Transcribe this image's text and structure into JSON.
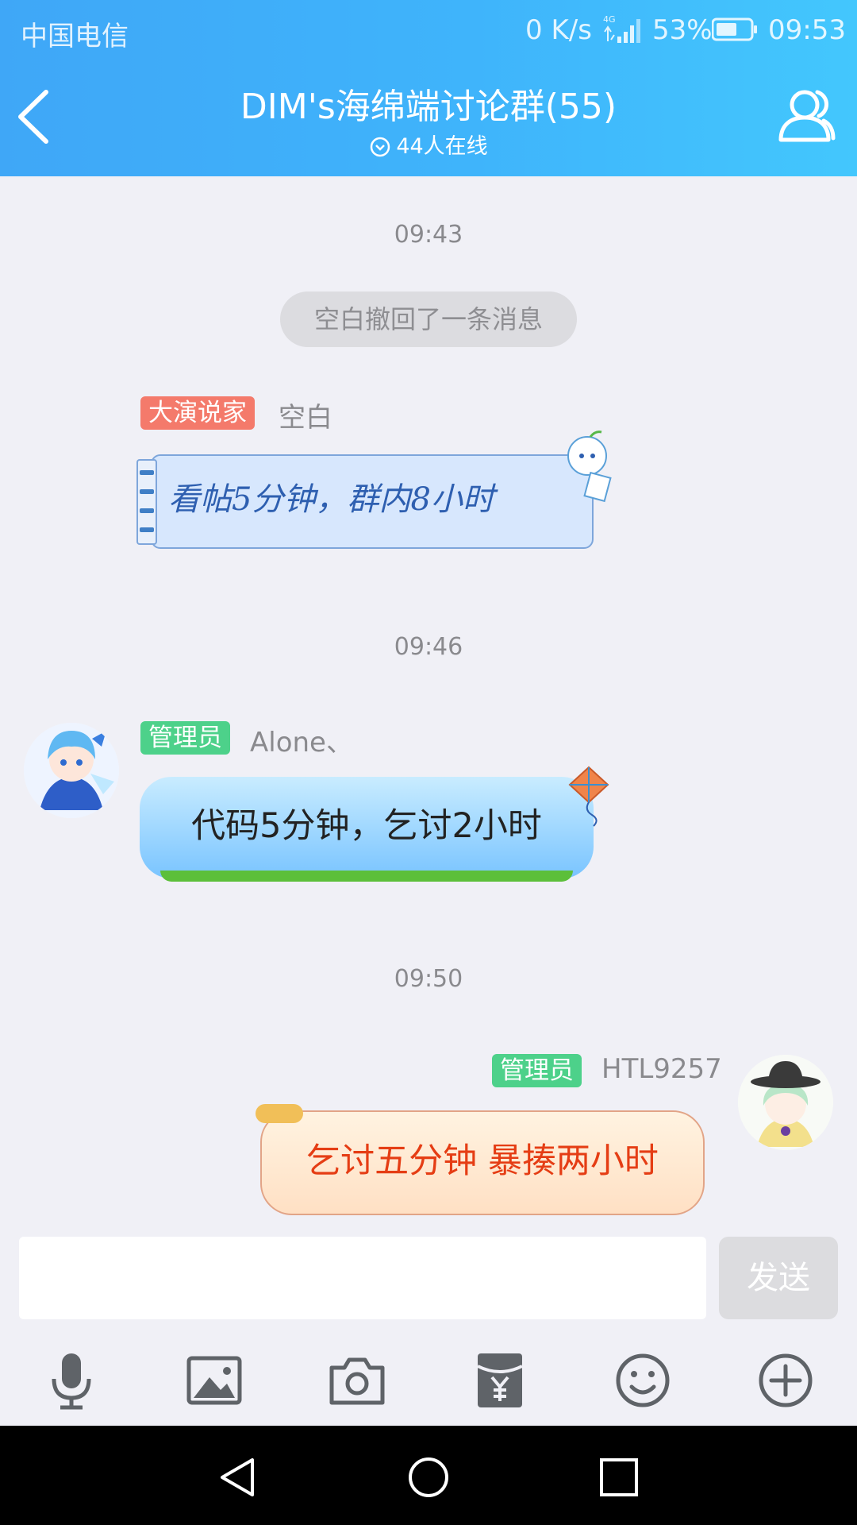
{
  "status_bar": {
    "carrier": "中国电信",
    "speed": "0 K/s",
    "network": "4G",
    "battery": "53%",
    "time": "09:53"
  },
  "header": {
    "title": "DIM's海绵端讨论群(55)",
    "online": "44人在线"
  },
  "chat": {
    "time1": "09:43",
    "recall_notice": "空白撤回了一条消息",
    "msg1": {
      "badge": "大演说家",
      "name": "空白",
      "text": "看帖5分钟，群内8小时"
    },
    "time2": "09:46",
    "msg2": {
      "badge": "管理员",
      "name": "Alone、",
      "text": "代码5分钟，乞讨2小时"
    },
    "time3": "09:50",
    "msg3": {
      "badge": "管理员",
      "name": "HTL9257",
      "text": "乞讨五分钟 暴揍两小时"
    }
  },
  "input": {
    "value": "",
    "send_label": "发送"
  },
  "toolbar": [
    "microphone-icon",
    "image-icon",
    "camera-icon",
    "red-packet-icon",
    "emoji-icon",
    "plus-icon"
  ],
  "colors": {
    "header": "#3fb4fb",
    "badge_red": "#f47a6b",
    "badge_green": "#4dd18a",
    "msg3_text": "#e53d14"
  }
}
